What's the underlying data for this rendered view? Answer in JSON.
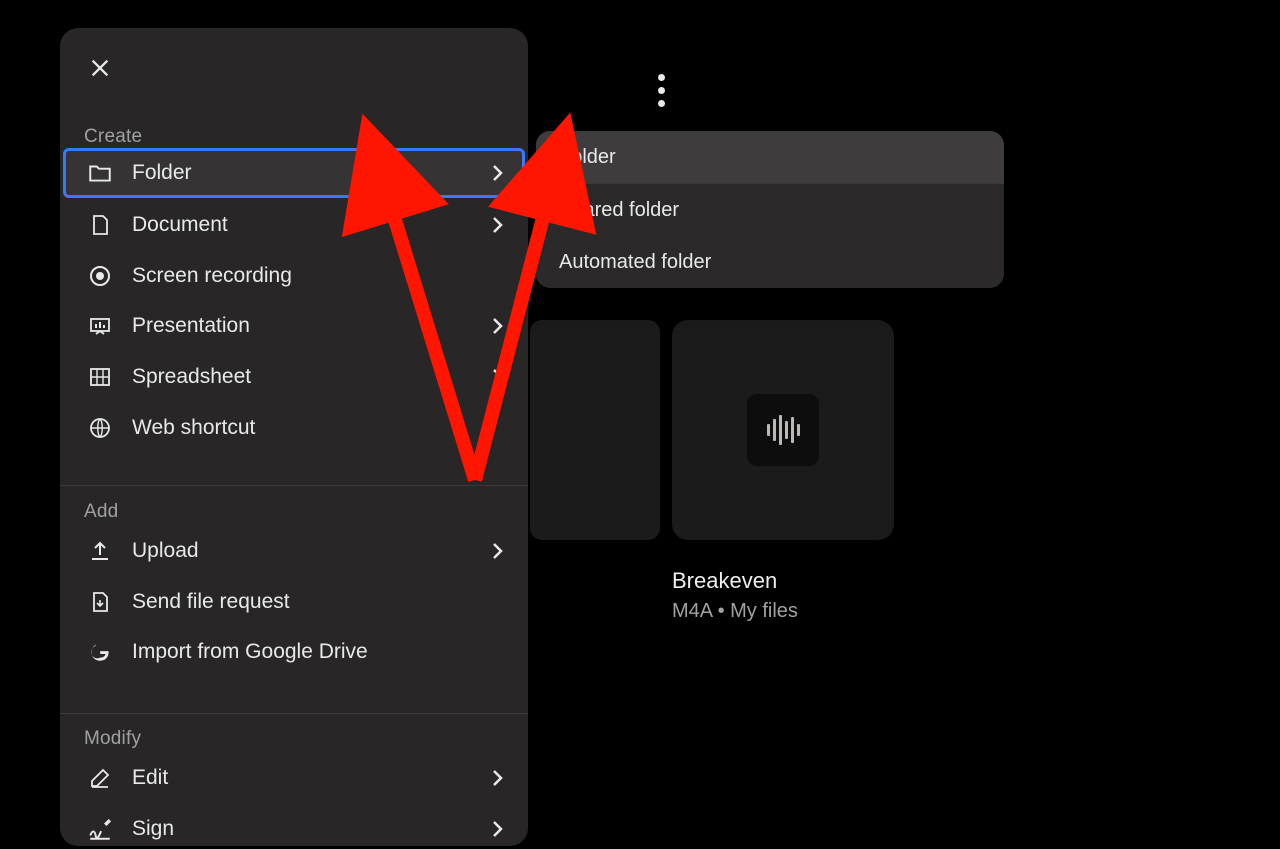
{
  "panel": {
    "sections": {
      "create": {
        "title": "Create"
      },
      "add": {
        "title": "Add"
      },
      "modify": {
        "title": "Modify"
      }
    },
    "items": {
      "folder": {
        "label": "Folder",
        "has_submenu": true,
        "highlighted": true
      },
      "document": {
        "label": "Document",
        "has_submenu": true
      },
      "screenrec": {
        "label": "Screen recording",
        "has_submenu": false
      },
      "presentation": {
        "label": "Presentation",
        "has_submenu": true
      },
      "spreadsheet": {
        "label": "Spreadsheet",
        "has_submenu": true
      },
      "webshortcut": {
        "label": "Web shortcut",
        "has_submenu": false
      },
      "upload": {
        "label": "Upload",
        "has_submenu": true
      },
      "sendfilereq": {
        "label": "Send file request",
        "has_submenu": false
      },
      "importgdrive": {
        "label": "Import from Google Drive",
        "has_submenu": false
      },
      "edit": {
        "label": "Edit",
        "has_submenu": true
      },
      "sign": {
        "label": "Sign",
        "has_submenu": true
      }
    }
  },
  "submenu": {
    "items": [
      {
        "label": "Folder",
        "active": true
      },
      {
        "label": "Shared folder"
      },
      {
        "label": "Automated folder"
      }
    ]
  },
  "file": {
    "name": "Breakeven",
    "meta": "M4A • My files"
  },
  "annotation": {
    "type": "arrows",
    "color": "#ff1500",
    "targets": [
      "menu-item-folder",
      "submenu-item-folder"
    ]
  }
}
